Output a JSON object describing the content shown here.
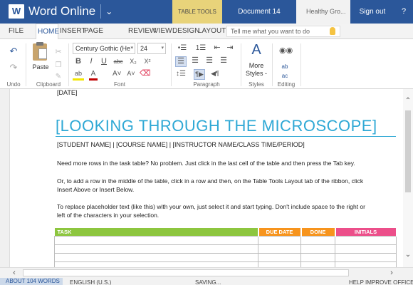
{
  "titlebar": {
    "app_name": "Word Online",
    "context_tab": "TABLE TOOLS",
    "document_name": "Document 14",
    "user_title": "Healthy Gro...",
    "sign_out": "Sign out",
    "help": "?"
  },
  "tabs": [
    "FILE",
    "HOME",
    "INSERT",
    "PAGE LAYOUT",
    "REVIEW",
    "VIEW",
    "DESIGN",
    "LAYOUT"
  ],
  "active_tab": "HOME",
  "tell_me_placeholder": "Tell me what you want to do",
  "ribbon": {
    "undo_group": "Undo",
    "clipboard": {
      "paste": "Paste",
      "label": "Clipboard"
    },
    "font": {
      "name": "Century Gothic (He",
      "size": "24",
      "label": "Font"
    },
    "paragraph_label": "Paragraph",
    "styles": {
      "button": "More Styles -",
      "label": "Styles"
    },
    "editing_label": "Editing"
  },
  "document": {
    "date": "[DATE]",
    "title": "[LOOKING THROUGH THE MICROSCOPE]",
    "subtitle": "[STUDENT NAME]  |  [COURSE NAME]  |  [INSTRUCTOR NAME/CLASS TIME/PERIOD]",
    "para1": "Need more rows in the task table? No problem. Just click in the last cell of the table and then press the Tab key.",
    "para2a": "Or, to add a row in the middle of the table, click in a row and then, on the Table Tools Layout tab of the ribbon, click",
    "para2b": "Insert Above or Insert Below.",
    "para3a": "To replace placeholder text (like this) with your own, just select it and start typing. Don't include space to the right or",
    "para3b": "left of the characters in your selection.",
    "table_headers": [
      "TASK",
      "DUE DATE",
      "DONE",
      "INITIALS"
    ],
    "header_colors": [
      "#8dc63f",
      "#f7941d",
      "#f7941d",
      "#ec4f8a"
    ]
  },
  "status": {
    "words": "ABOUT 104 WORDS",
    "language": "ENGLISH (U.S.)",
    "saving": "SAVING...",
    "improve": "HELP IMPROVE OFFICE"
  }
}
